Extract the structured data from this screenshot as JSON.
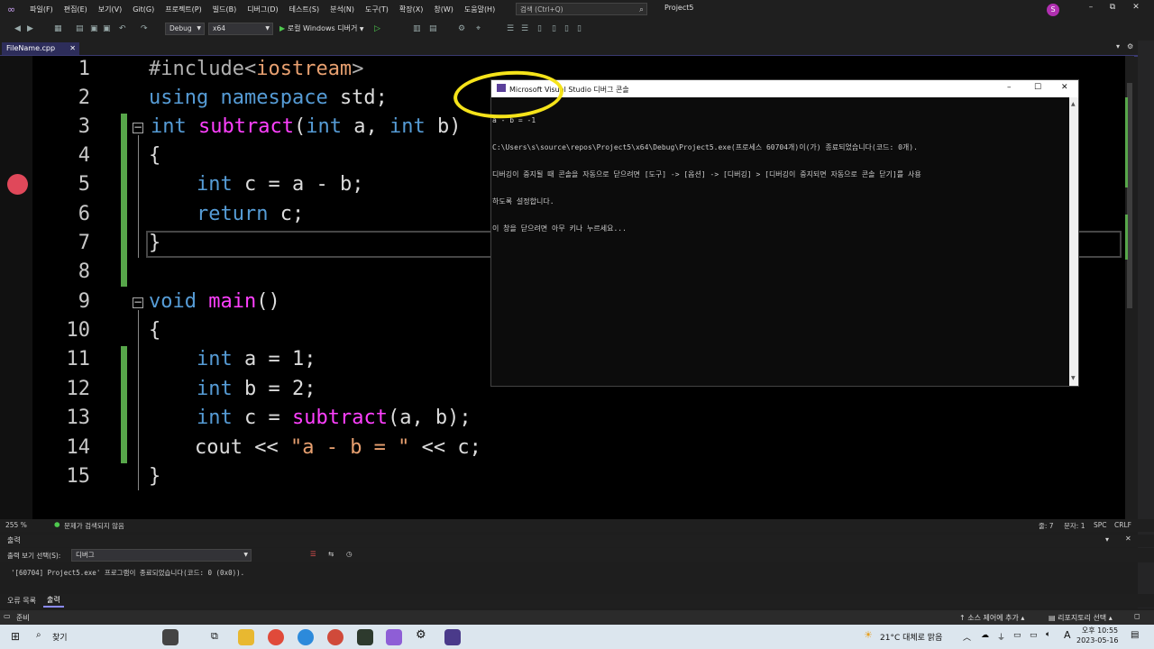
{
  "menu": {
    "items": [
      "파일(F)",
      "편집(E)",
      "보기(V)",
      "Git(G)",
      "프로젝트(P)",
      "빌드(B)",
      "디버그(D)",
      "테스트(S)",
      "분석(N)",
      "도구(T)",
      "확장(X)",
      "창(W)",
      "도움말(H)"
    ],
    "search_placeholder": "검색 (Ctrl+Q)",
    "project_name": "Project5",
    "avatar_letter": "S"
  },
  "toolbar": {
    "config": "Debug",
    "platform": "x64",
    "run_label": "로컬 Windows 디버거"
  },
  "tab": {
    "filename": "FileName.cpp"
  },
  "editor": {
    "line_numbers": [
      "1",
      "2",
      "3",
      "4",
      "5",
      "6",
      "7",
      "8",
      "9",
      "10",
      "11",
      "12",
      "13",
      "14",
      "15"
    ],
    "lines": {
      "l1_a": "#include<",
      "l1_b": "iostream",
      "l1_c": ">",
      "l2_a": "using",
      "l2_b": " namespace ",
      "l2_c": "std;",
      "l3_a": "int",
      "l3_b": "subtract",
      "l3_c": "(",
      "l3_d": "int",
      "l3_e": " a, ",
      "l3_f": "int",
      "l3_g": " b)",
      "l4": "{",
      "l5_a": "int",
      "l5_b": " c = a - b;",
      "l6_a": "return",
      "l6_b": " c;",
      "l7": "}",
      "l9_a": "void",
      "l9_b": "main",
      "l9_c": "()",
      "l10": "{",
      "l11_a": "int",
      "l11_b": " a = 1;",
      "l12_a": "int",
      "l12_b": " b = 2;",
      "l13_a": "int",
      "l13_b": " c = ",
      "l13_c": "subtract",
      "l13_d": "(a, b);",
      "l14_a": "cout << ",
      "l14_b": "\"a - b = \"",
      "l14_c": " << c;",
      "l15": "}"
    }
  },
  "editor_status": {
    "zoom": "255 %",
    "issues": "문제가 검색되지 않음",
    "line": "줄: 7",
    "char": "문자: 1",
    "mode": "SPC",
    "eol": "CRLF"
  },
  "output": {
    "title": "출력",
    "source_label": "출력 보기 선택(S):",
    "source_value": "디버그",
    "lines": [
      "'[60704] Project5.exe' 프로그램이 종료되었습니다(코드: 0 (0x0))."
    ]
  },
  "bottom_tabs": [
    "오류 목록",
    "출력"
  ],
  "status": {
    "ready": "준비",
    "source_control": "소스 제어에 추가",
    "repo": "리포지토리 선택"
  },
  "console": {
    "title": "Microsoft Visual Studio 디버그 콘솔",
    "lines": [
      "a - b = -1",
      "C:\\Users\\s\\source\\repos\\Project5\\x64\\Debug\\Project5.exe(프로세스 60704개)이(가) 종료되었습니다(코드: 0개).",
      "디버깅이 중지될 때 콘솔을 자동으로 닫으려면 [도구] -> [옵션] -> [디버깅] > [디버깅이 중지되면 자동으로 콘솔 닫기]를 사용",
      "하도록 설정합니다.",
      "이 창을 닫으려면 아무 키나 누르세요..."
    ]
  },
  "taskbar": {
    "search": "찾기",
    "weather": "21°C  대체로 맑음",
    "ime": "A",
    "time": "오후 10:55",
    "date": "2023-05-16"
  }
}
